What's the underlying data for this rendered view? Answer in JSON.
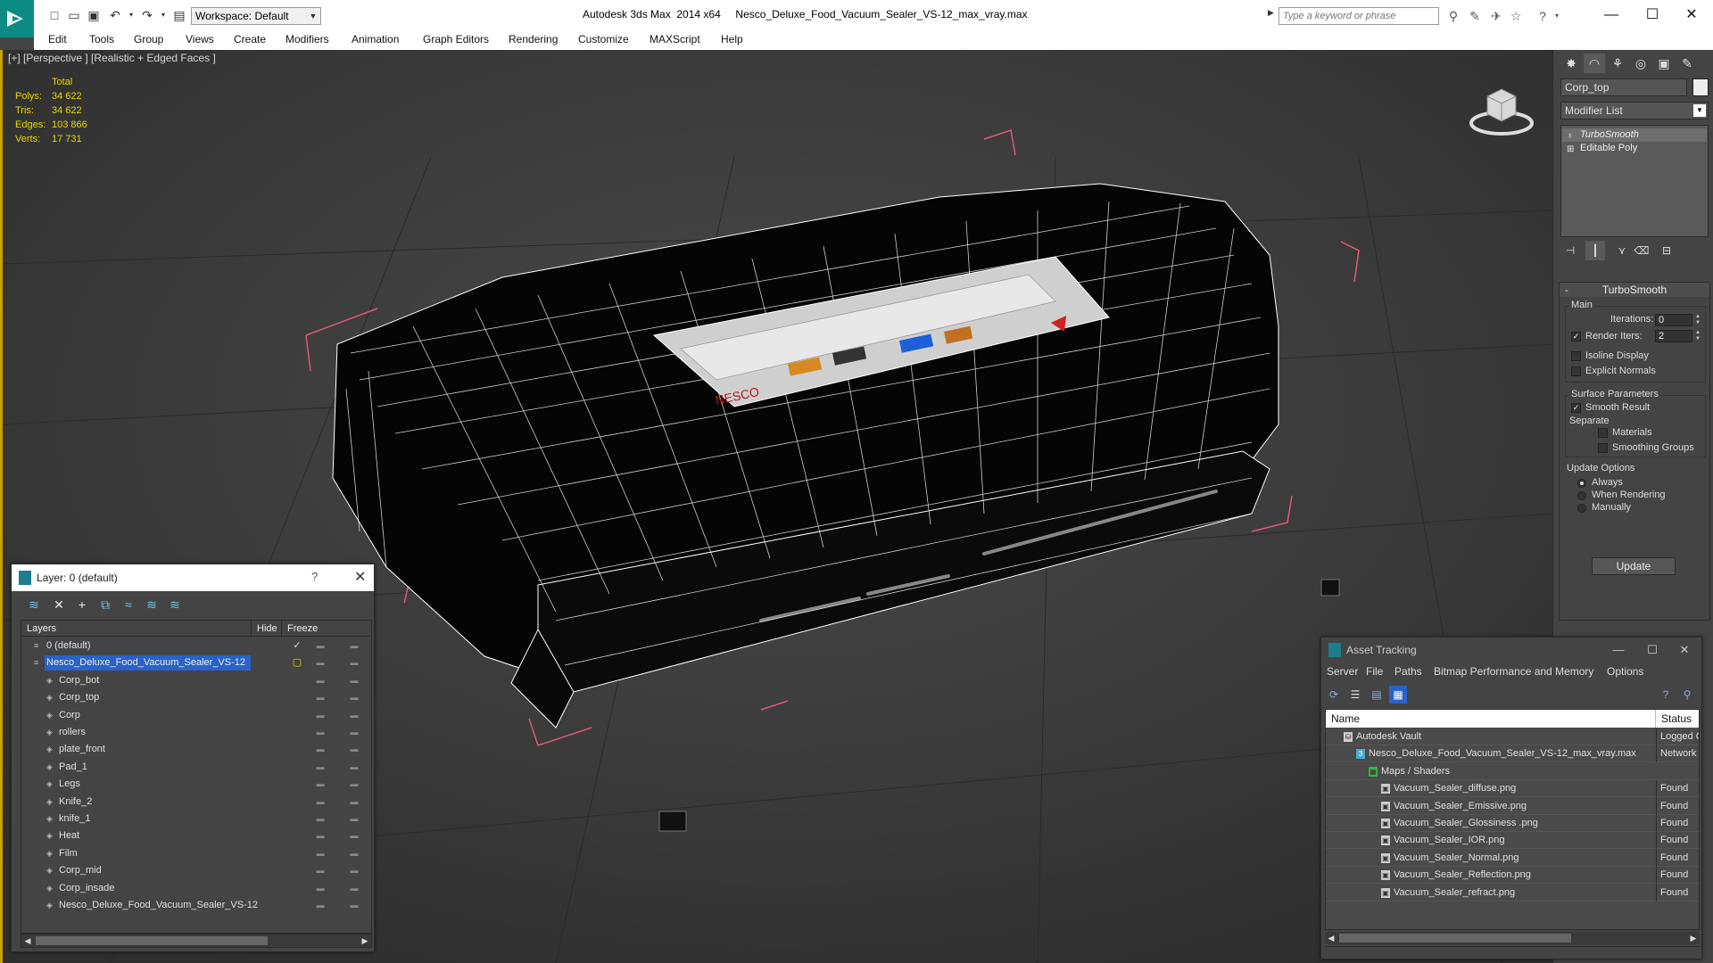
{
  "app": {
    "title": "Autodesk 3ds Max  2014 x64     Nesco_Deluxe_Food_Vacuum_Sealer_VS-12_max_vray.max",
    "workspace": "Workspace: Default",
    "search_placeholder": "Type a keyword or phrase"
  },
  "menu": [
    "Edit",
    "Tools",
    "Group",
    "Views",
    "Create",
    "Modifiers",
    "Animation",
    "Graph Editors",
    "Rendering",
    "Customize",
    "MAXScript",
    "Help"
  ],
  "viewport": {
    "label": "[+] [Perspective ] [Realistic + Edged Faces ]",
    "stats": {
      "header": "Total",
      "rows": [
        {
          "label": "Polys:",
          "value": "34 622"
        },
        {
          "label": "Tris:",
          "value": "34 622"
        },
        {
          "label": "Edges:",
          "value": "103 866"
        },
        {
          "label": "Verts:",
          "value": "17 731"
        }
      ]
    },
    "model_text": "NESCO"
  },
  "command_panel": {
    "object_name": "Corp_top",
    "modifier_list": "Modifier List",
    "stack": [
      "TurboSmooth",
      "Editable Poly"
    ],
    "rollout": {
      "title": "TurboSmooth",
      "main": "Main",
      "iterations_label": "Iterations:",
      "iterations_value": "0",
      "render_iters_label": "Render Iters:",
      "render_iters_value": "2",
      "isoline": "Isoline Display",
      "explicit_normals": "Explicit Normals",
      "surface_params": "Surface Parameters",
      "smooth_result": "Smooth Result",
      "separate": "Separate",
      "materials": "Materials",
      "smoothing_groups": "Smoothing Groups",
      "update_options": "Update Options",
      "always": "Always",
      "when_rendering": "When Rendering",
      "manually": "Manually",
      "update_button": "Update"
    }
  },
  "layer_window": {
    "title": "Layer: 0 (default)",
    "help": "?",
    "columns": {
      "layers": "Layers",
      "hide": "Hide",
      "freeze": "Freeze"
    },
    "rows": [
      {
        "name": "0 (default)",
        "level": 0,
        "checked": true,
        "selected": false
      },
      {
        "name": "Nesco_Deluxe_Food_Vacuum_Sealer_VS-12",
        "level": 0,
        "checked": false,
        "selected": true
      },
      {
        "name": "Corp_bot",
        "level": 1
      },
      {
        "name": "Corp_top",
        "level": 1
      },
      {
        "name": "Corp",
        "level": 1
      },
      {
        "name": "rollers",
        "level": 1
      },
      {
        "name": "plate_front",
        "level": 1
      },
      {
        "name": "Pad_1",
        "level": 1
      },
      {
        "name": "Legs",
        "level": 1
      },
      {
        "name": "Knife_2",
        "level": 1
      },
      {
        "name": "knife_1",
        "level": 1
      },
      {
        "name": "Heat",
        "level": 1
      },
      {
        "name": "Film",
        "level": 1
      },
      {
        "name": "Corp_mid",
        "level": 1
      },
      {
        "name": "Corp_insade",
        "level": 1
      },
      {
        "name": "Nesco_Deluxe_Food_Vacuum_Sealer_VS-12",
        "level": 1
      }
    ]
  },
  "asset_window": {
    "title": "Asset Tracking",
    "menu": [
      "Server",
      "File",
      "Paths",
      "Bitmap Performance and Memory",
      "Options"
    ],
    "columns": {
      "name": "Name",
      "status": "Status"
    },
    "rows": [
      {
        "name": "Autodesk Vault",
        "status": "Logged O",
        "level": 0
      },
      {
        "name": "Nesco_Deluxe_Food_Vacuum_Sealer_VS-12_max_vray.max",
        "status": "Network",
        "level": 1
      },
      {
        "name": "Maps / Shaders",
        "status": "",
        "level": 2
      },
      {
        "name": "Vacuum_Sealer_diffuse.png",
        "status": "Found",
        "level": 3
      },
      {
        "name": "Vacuum_Sealer_Emissive.png",
        "status": "Found",
        "level": 3
      },
      {
        "name": "Vacuum_Sealer_Glossiness .png",
        "status": "Found",
        "level": 3
      },
      {
        "name": "Vacuum_Sealer_IOR.png",
        "status": "Found",
        "level": 3
      },
      {
        "name": "Vacuum_Sealer_Normal.png",
        "status": "Found",
        "level": 3
      },
      {
        "name": "Vacuum_Sealer_Reflection.png",
        "status": "Found",
        "level": 3
      },
      {
        "name": "Vacuum_Sealer_refract.png",
        "status": "Found",
        "level": 3
      }
    ]
  },
  "colors": {
    "accent_teal": "#0c8a84",
    "selection_blue": "#2a62c8",
    "stats_yellow": "#e8d800",
    "viewport_bg": "#3d3d3d",
    "bbox_pink": "#e05878"
  }
}
